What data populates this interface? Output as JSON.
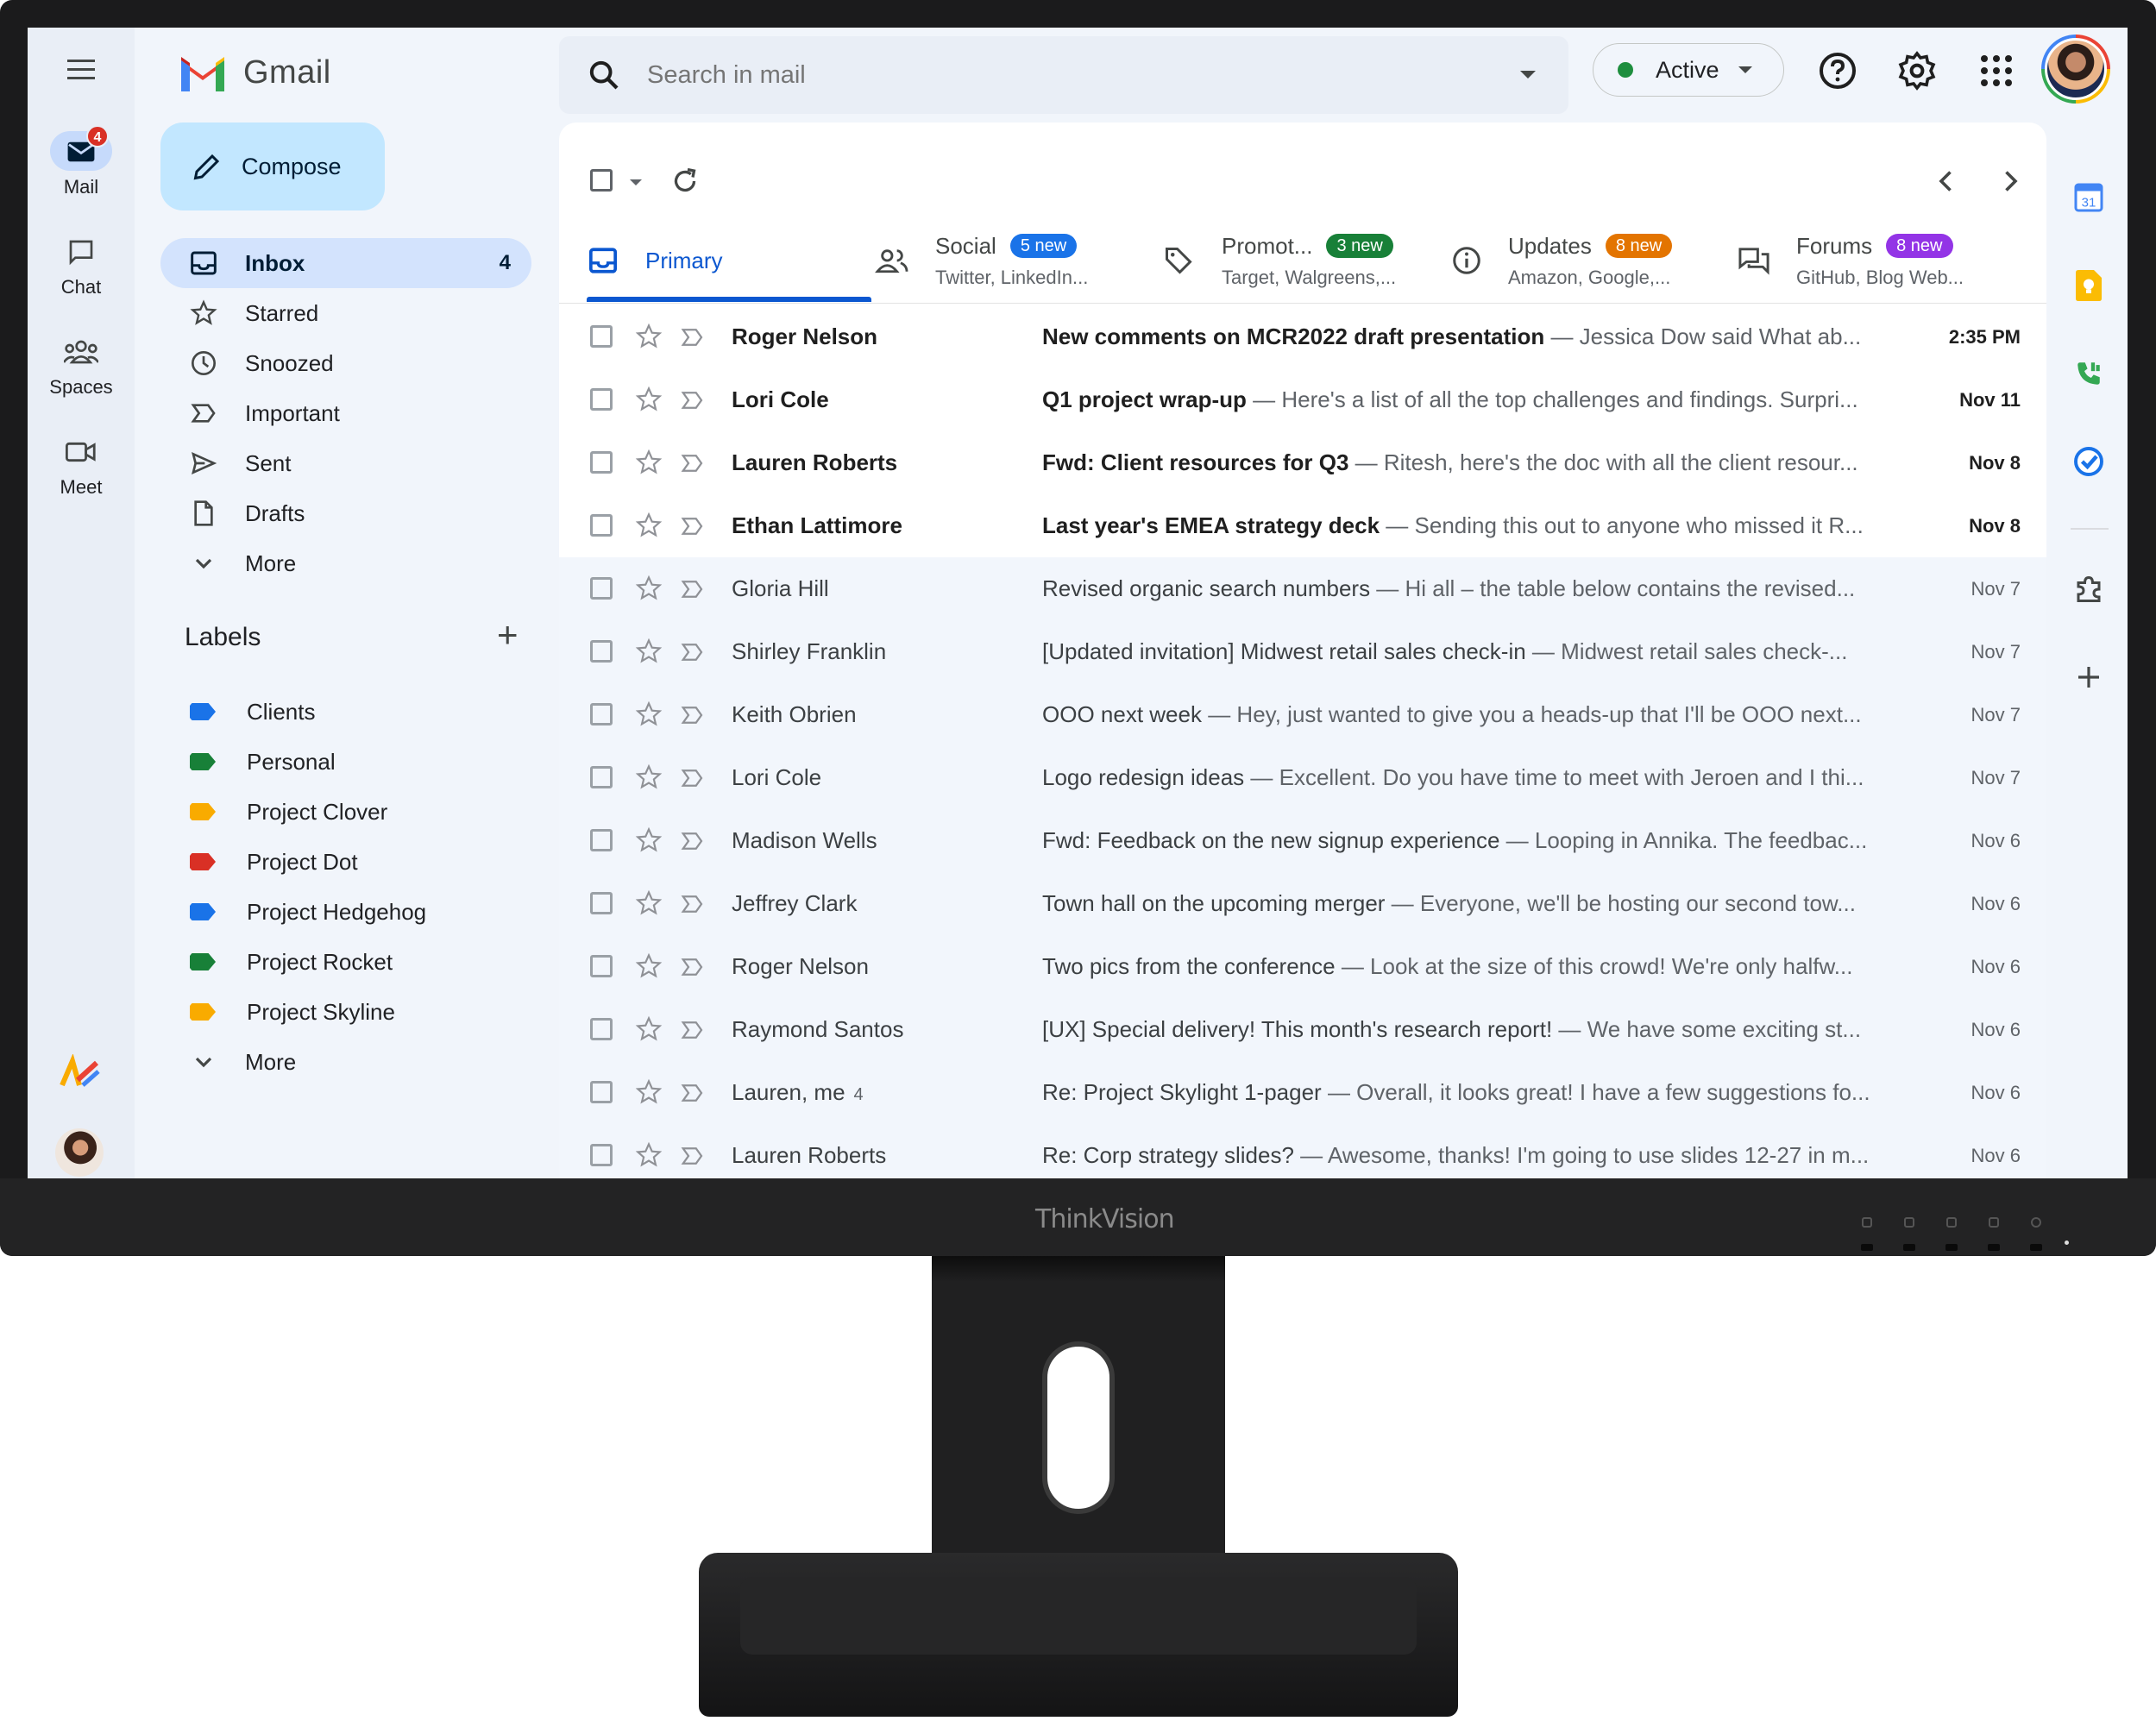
{
  "app": {
    "name": "Gmail",
    "brand_colors": {
      "red": "#ea4335",
      "blue": "#4285f4",
      "green": "#34a853",
      "yellow": "#fbbc04"
    }
  },
  "hardware": {
    "monitor_brand": "ThinkVision"
  },
  "rail": {
    "menu_icon": "hamburger-menu-icon",
    "items": [
      {
        "label": "Mail",
        "icon": "mail-icon",
        "badge": "4",
        "active": true
      },
      {
        "label": "Chat",
        "icon": "chat-icon",
        "active": false
      },
      {
        "label": "Spaces",
        "icon": "spaces-icon",
        "active": false
      },
      {
        "label": "Meet",
        "icon": "video-icon",
        "active": false
      }
    ]
  },
  "sidebar": {
    "compose_label": "Compose",
    "nav": [
      {
        "label": "Inbox",
        "icon": "inbox-icon",
        "count": "4",
        "active": true
      },
      {
        "label": "Starred",
        "icon": "star-icon"
      },
      {
        "label": "Snoozed",
        "icon": "clock-icon"
      },
      {
        "label": "Important",
        "icon": "important-icon"
      },
      {
        "label": "Sent",
        "icon": "send-icon"
      },
      {
        "label": "Drafts",
        "icon": "draft-icon"
      },
      {
        "label": "More",
        "icon": "chevron-down-icon"
      }
    ],
    "labels_title": "Labels",
    "labels_add_icon": "plus-icon",
    "labels": [
      {
        "label": "Clients",
        "color": "#1a73e8"
      },
      {
        "label": "Personal",
        "color": "#188038"
      },
      {
        "label": "Project Clover",
        "color": "#f9ab00"
      },
      {
        "label": "Project Dot",
        "color": "#d93025"
      },
      {
        "label": "Project Hedgehog",
        "color": "#1a73e8"
      },
      {
        "label": "Project Rocket",
        "color": "#188038"
      },
      {
        "label": "Project Skyline",
        "color": "#f9ab00"
      }
    ],
    "labels_more": "More"
  },
  "header": {
    "search_placeholder": "Search in mail",
    "status_label": "Active",
    "status_color": "#1e8e3e",
    "icons": [
      "help-icon",
      "settings-icon",
      "apps-grid-icon"
    ]
  },
  "tabs": [
    {
      "name": "Primary",
      "sub": "",
      "badge": "",
      "badge_color": "",
      "icon": "inbox-tab-icon",
      "active": true
    },
    {
      "name": "Social",
      "sub": "Twitter, LinkedIn...",
      "badge": "5 new",
      "badge_color": "#1a73e8",
      "icon": "people-icon"
    },
    {
      "name": "Promot...",
      "sub": "Target, Walgreens,...",
      "badge": "3 new",
      "badge_color": "#188038",
      "icon": "tag-icon"
    },
    {
      "name": "Updates",
      "sub": "Amazon, Google,...",
      "badge": "8 new",
      "badge_color": "#e37400",
      "icon": "info-icon"
    },
    {
      "name": "Forums",
      "sub": "GitHub, Blog Web...",
      "badge": "8 new",
      "badge_color": "#9334e6",
      "icon": "forum-icon"
    }
  ],
  "emails": [
    {
      "sender": "Roger Nelson",
      "thread": "",
      "subject": "New comments on MCR2022 draft presentation",
      "snippet": " — Jessica Dow said What ab...",
      "date": "2:35 PM",
      "unread": true
    },
    {
      "sender": "Lori Cole",
      "thread": "",
      "subject": "Q1 project wrap-up",
      "snippet": " — Here's a list of all the top challenges and findings. Surpri...",
      "date": "Nov 11",
      "unread": true
    },
    {
      "sender": "Lauren Roberts",
      "thread": "",
      "subject": "Fwd: Client resources for Q3",
      "snippet": " — Ritesh, here's the doc with all the client resour...",
      "date": "Nov 8",
      "unread": true
    },
    {
      "sender": "Ethan Lattimore",
      "thread": "",
      "subject": "Last year's EMEA strategy deck",
      "snippet": " — Sending this out to anyone who missed it R...",
      "date": "Nov 8",
      "unread": true
    },
    {
      "sender": "Gloria Hill",
      "thread": "",
      "subject": "Revised organic search numbers",
      "snippet": " — Hi all – the table below contains the revised...",
      "date": "Nov 7",
      "unread": false
    },
    {
      "sender": "Shirley Franklin",
      "thread": "",
      "subject": "[Updated invitation] Midwest retail sales check-in",
      "snippet": " — Midwest retail sales check-...",
      "date": "Nov 7",
      "unread": false
    },
    {
      "sender": "Keith Obrien",
      "thread": "",
      "subject": "OOO next week",
      "snippet": " — Hey, just wanted to give you a heads-up that I'll be OOO next...",
      "date": "Nov 7",
      "unread": false
    },
    {
      "sender": "Lori Cole",
      "thread": "",
      "subject": "Logo redesign ideas",
      "snippet": " — Excellent. Do you have time to meet with Jeroen and I thi...",
      "date": "Nov 7",
      "unread": false
    },
    {
      "sender": "Madison Wells",
      "thread": "",
      "subject": "Fwd: Feedback on the new signup experience",
      "snippet": " — Looping in Annika. The feedbac...",
      "date": "Nov 6",
      "unread": false
    },
    {
      "sender": "Jeffrey Clark",
      "thread": "",
      "subject": "Town hall on the upcoming merger",
      "snippet": " — Everyone, we'll be hosting our second tow...",
      "date": "Nov 6",
      "unread": false
    },
    {
      "sender": "Roger Nelson",
      "thread": "",
      "subject": "Two pics from the conference",
      "snippet": " — Look at the size of this crowd! We're only halfw...",
      "date": "Nov 6",
      "unread": false
    },
    {
      "sender": "Raymond Santos",
      "thread": "",
      "subject": "[UX] Special delivery! This month's research report!",
      "snippet": " — We have some exciting st...",
      "date": "Nov 6",
      "unread": false
    },
    {
      "sender": "Lauren, me",
      "thread": "4",
      "subject": "Re: Project Skylight 1-pager",
      "snippet": " — Overall, it looks great! I have a few suggestions fo...",
      "date": "Nov 6",
      "unread": false
    },
    {
      "sender": "Lauren Roberts",
      "thread": "",
      "subject": "Re: Corp strategy slides?",
      "snippet": " — Awesome, thanks! I'm going to use slides 12-27 in m...",
      "date": "Nov 6",
      "unread": false
    }
  ],
  "side_panel": {
    "apps": [
      "calendar-icon",
      "keep-icon",
      "voice-icon",
      "tasks-icon",
      "addons-icon",
      "add-icon"
    ],
    "calendar_day": "31"
  }
}
